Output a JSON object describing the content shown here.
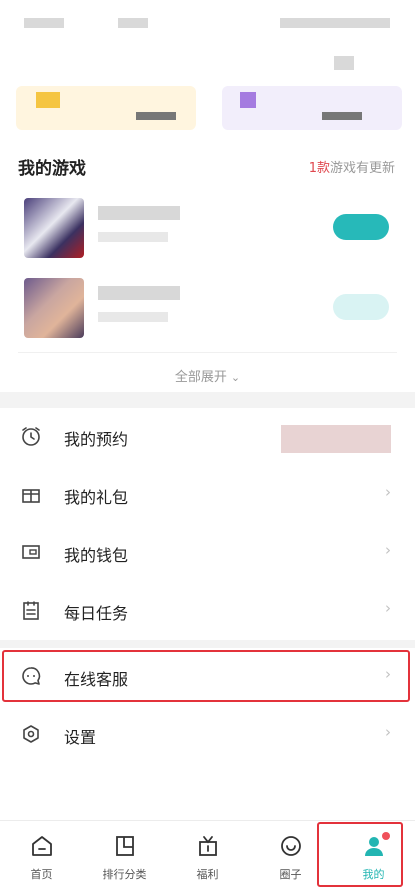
{
  "section": {
    "title": "我的游戏",
    "update_count": "1款",
    "update_suffix": "游戏有更新"
  },
  "expand_label": "全部展开",
  "menu": {
    "reservations": "我的预约",
    "gifts": "我的礼包",
    "wallet": "我的钱包",
    "daily_tasks": "每日任务",
    "support": "在线客服",
    "settings": "设置"
  },
  "tabbar": {
    "home": "首页",
    "ranking": "排行分类",
    "welfare": "福利",
    "circle": "圈子",
    "mine": "我的"
  },
  "colors": {
    "accent": "#22b5b2",
    "highlight_border": "#e3323b",
    "badge_red": "#f0505a"
  }
}
